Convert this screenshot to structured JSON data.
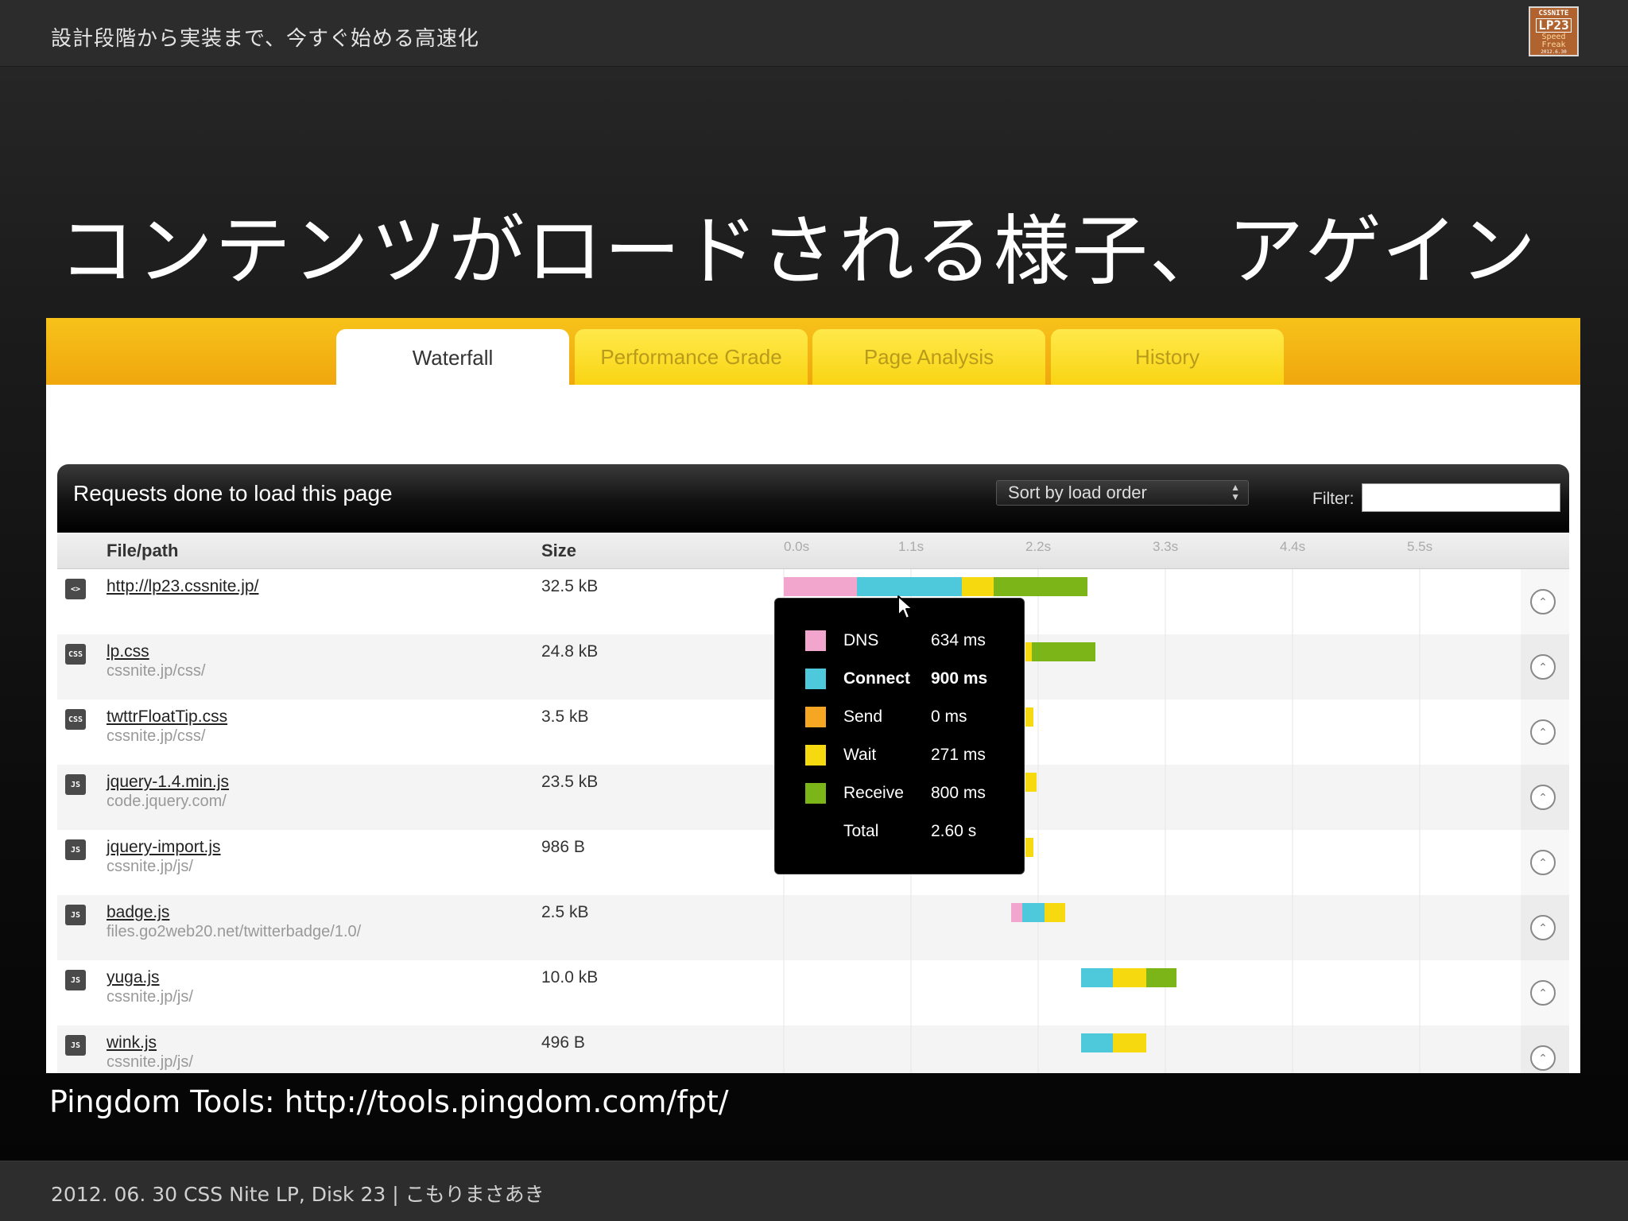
{
  "header": {
    "title": "設計段階から実装まで、今すぐ始める高速化",
    "logo": {
      "line1": "CSSNITE",
      "line2": "LP23",
      "line3": "Speed",
      "line4": "Freak",
      "line5": "2012.6.30"
    }
  },
  "slide": {
    "title": "コンテンツがロードされる様子、アゲイン",
    "caption": "Pingdom Tools: http://tools.pingdom.com/fpt/"
  },
  "tabs": [
    {
      "label": "Waterfall",
      "active": true
    },
    {
      "label": "Performance Grade",
      "active": false
    },
    {
      "label": "Page Analysis",
      "active": false
    },
    {
      "label": "History",
      "active": false
    }
  ],
  "panel": {
    "title": "Requests done to load this page",
    "sort_value": "Sort by load order",
    "filter_label": "Filter:",
    "filter_value": ""
  },
  "columns": {
    "file": "File/path",
    "size": "Size",
    "ticks": [
      "0.0s",
      "1.1s",
      "2.2s",
      "3.3s",
      "4.4s",
      "5.5s"
    ]
  },
  "colors": {
    "dns": "#f2a6cd",
    "connect": "#4ec9dc",
    "send": "#f5a623",
    "wait": "#f7d90f",
    "receive": "#7cb518",
    "tab_band": "#f7b712"
  },
  "rows": [
    {
      "type": "<>",
      "name": "http://lp23.cssnite.jp/",
      "path": "",
      "size": "32.5 kB"
    },
    {
      "type": "CSS",
      "name": "lp.css",
      "path": "cssnite.jp/css/",
      "size": "24.8 kB"
    },
    {
      "type": "CSS",
      "name": "twttrFloatTip.css",
      "path": "cssnite.jp/css/",
      "size": "3.5 kB"
    },
    {
      "type": "JS",
      "name": "jquery-1.4.min.js",
      "path": "code.jquery.com/",
      "size": "23.5 kB"
    },
    {
      "type": "JS",
      "name": "jquery-import.js",
      "path": "cssnite.jp/js/",
      "size": "986 B"
    },
    {
      "type": "JS",
      "name": "badge.js",
      "path": "files.go2web20.net/twitterbadge/1.0/",
      "size": "2.5 kB"
    },
    {
      "type": "JS",
      "name": "yuga.js",
      "path": "cssnite.jp/js/",
      "size": "10.0 kB"
    },
    {
      "type": "JS",
      "name": "wink.js",
      "path": "cssnite.jp/js/",
      "size": "496 B"
    }
  ],
  "tooltip": [
    {
      "label": "DNS",
      "value": "634 ms",
      "color": "#f2a6cd",
      "bold": false
    },
    {
      "label": "Connect",
      "value": "900 ms",
      "color": "#4ec9dc",
      "bold": true
    },
    {
      "label": "Send",
      "value": "0 ms",
      "color": "#f5a623",
      "bold": false
    },
    {
      "label": "Wait",
      "value": "271 ms",
      "color": "#f7d90f",
      "bold": false
    },
    {
      "label": "Receive",
      "value": "800 ms",
      "color": "#7cb518",
      "bold": false
    },
    {
      "label": "Total",
      "value": "2.60 s",
      "color": "",
      "bold": false
    }
  ],
  "footer": {
    "event": "2012. 06. 30 CSS Nite LP, Disk 23",
    "separator": "|",
    "author": "こもりまさあき"
  }
}
